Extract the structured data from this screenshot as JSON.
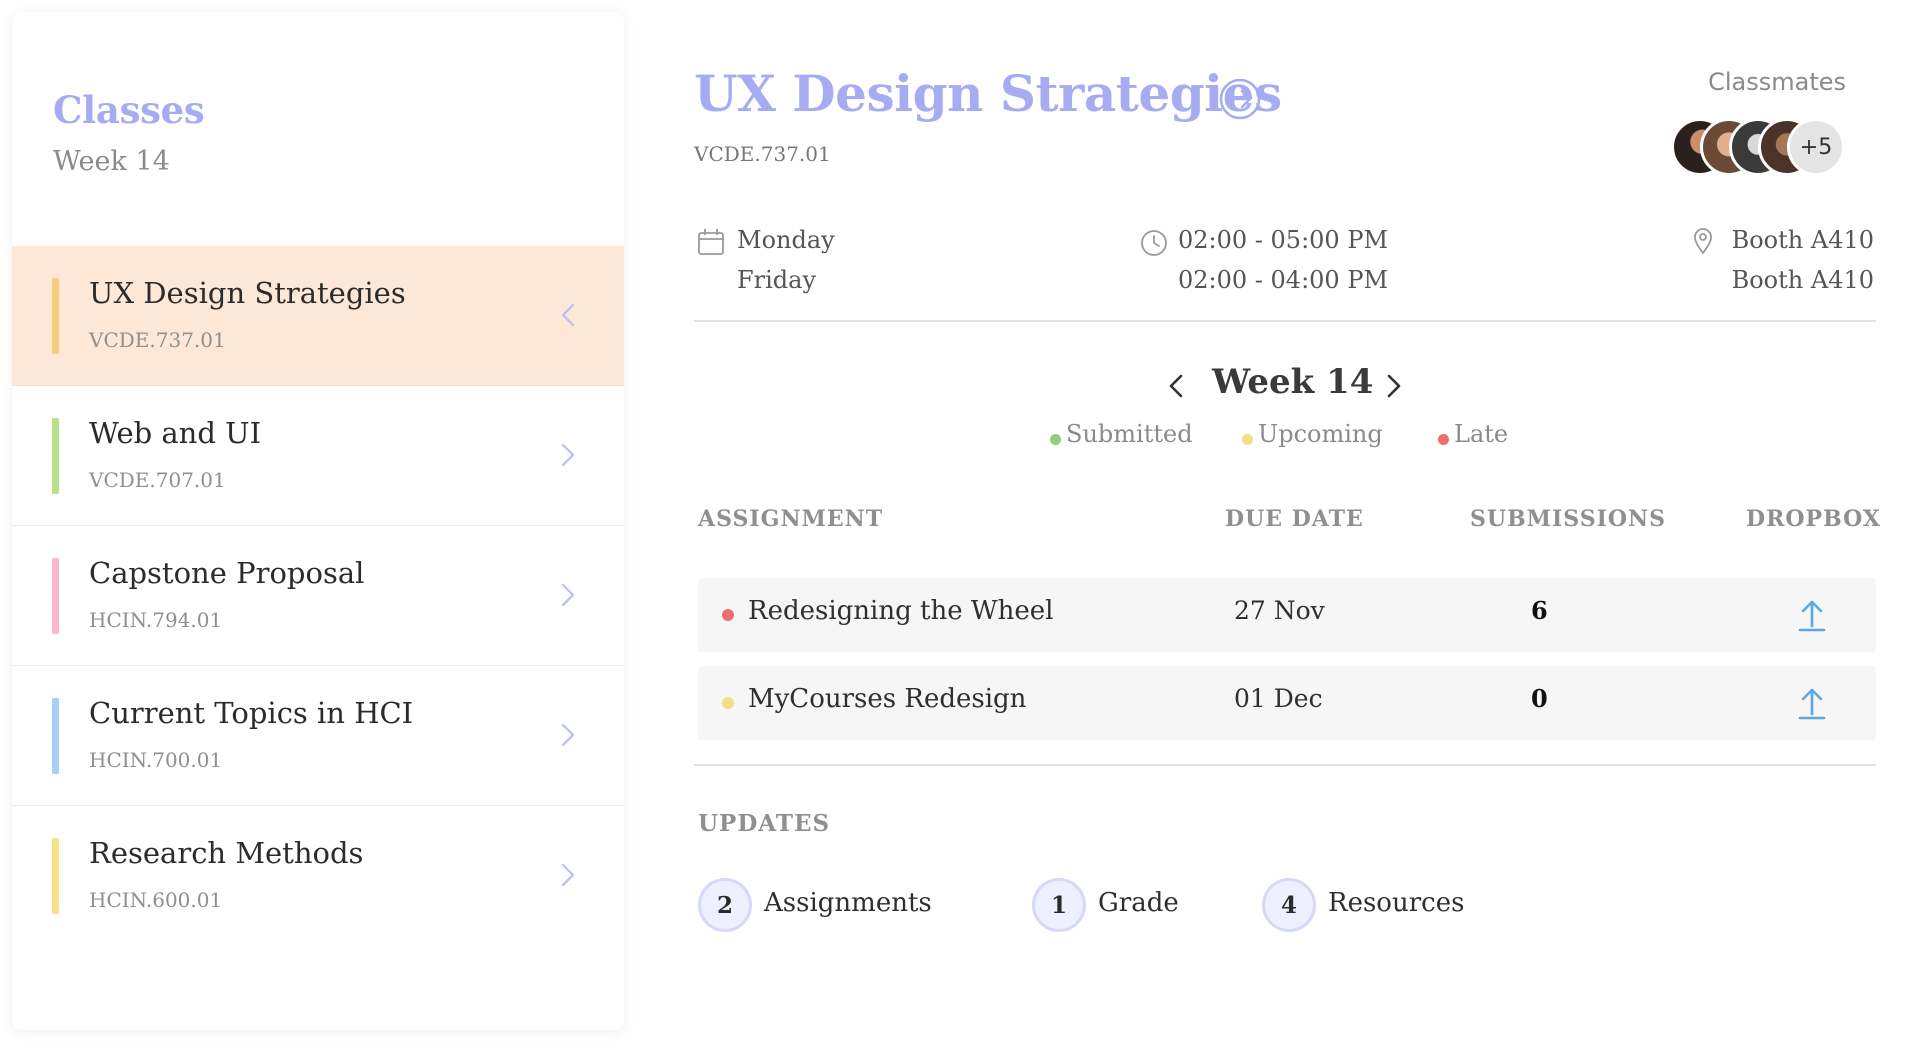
{
  "sidebar": {
    "title": "Classes",
    "subtitle": "Week 14",
    "classes": [
      {
        "name": "UX Design Strategies",
        "code": "VCDE.737.01",
        "color": "#f5cd7e",
        "active": true
      },
      {
        "name": "Web and UI",
        "code": "VCDE.707.01",
        "color": "#b6e387",
        "active": false
      },
      {
        "name": "Capstone Proposal",
        "code": "HCIN.794.01",
        "color": "#f9b8cf",
        "active": false
      },
      {
        "name": "Current Topics in HCI",
        "code": "HCIN.700.01",
        "color": "#a9cff7",
        "active": false
      },
      {
        "name": "Research Methods",
        "code": "HCIN.600.01",
        "color": "#f8e08a",
        "active": false
      }
    ]
  },
  "course": {
    "title": "UX Design Strategies",
    "code": "VCDE.737.01",
    "accent_color": "#a6acf2"
  },
  "classmates": {
    "label": "Classmates",
    "more": "+5"
  },
  "schedule": {
    "days": [
      "Monday",
      "Friday"
    ],
    "times": [
      "02:00 - 05:00 PM",
      "02:00 - 04:00 PM"
    ],
    "locations": [
      "Booth A410",
      "Booth A410"
    ],
    "icons": [
      "calendar-icon",
      "clock-icon",
      "location-pin-icon"
    ]
  },
  "week_nav": {
    "label": "Week 14"
  },
  "legend": [
    {
      "label": "Submitted",
      "color": "#8ed17c"
    },
    {
      "label": "Upcoming",
      "color": "#f2df83"
    },
    {
      "label": "Late",
      "color": "#ee6e6e"
    }
  ],
  "table": {
    "headers": [
      "ASSIGNMENT",
      "DUE DATE",
      "SUBMISSIONS",
      "DROPBOX"
    ],
    "rows": [
      {
        "name": "Redesigning the Wheel",
        "due": "27 Nov",
        "submissions": "6",
        "status_color": "#ee6e6e"
      },
      {
        "name": "MyCourses Redesign",
        "due": "01 Dec",
        "submissions": "0",
        "status_color": "#f2df83"
      }
    ],
    "upload_color": "#5aa8e6"
  },
  "updates": {
    "title": "UPDATES",
    "items": [
      {
        "count": "2",
        "label": "Assignments"
      },
      {
        "count": "1",
        "label": "Grade"
      },
      {
        "count": "4",
        "label": "Resources"
      }
    ]
  }
}
